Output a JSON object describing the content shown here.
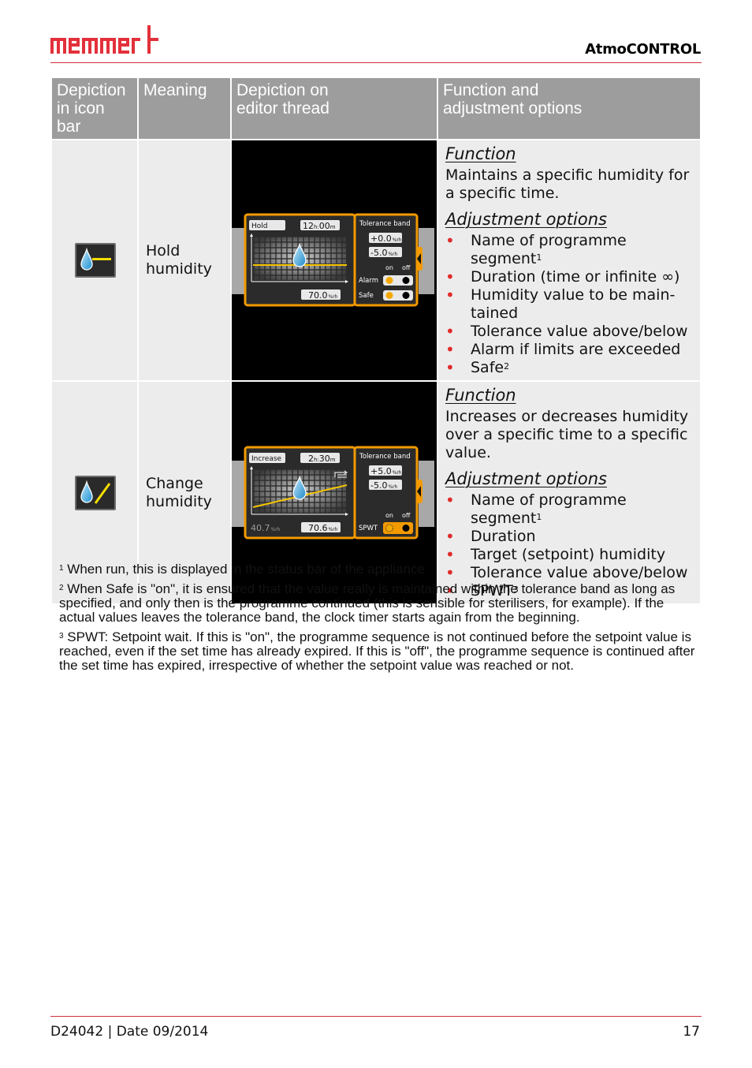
{
  "header": {
    "brand": "memmert",
    "product": "AtmoCONTROL",
    "brand_color": "#e3303b"
  },
  "table": {
    "columns": [
      "Depiction in icon bar",
      "Meaning",
      "Depiction on editor thread",
      "Function and adjustment options"
    ],
    "column_lines": [
      [
        "Depiction",
        "in icon bar"
      ],
      [
        "Meaning"
      ],
      [
        "Depiction on",
        "editor thread"
      ],
      [
        "Function and",
        "adjustment options"
      ]
    ],
    "rows": [
      {
        "icon": "hold-humidity-icon",
        "meaning_lines": [
          "Hold",
          "humidity"
        ],
        "thread": {
          "segment_name": "Hold",
          "duration_h": "12",
          "duration_m": "00",
          "unit_h": "h:",
          "unit_m": "m",
          "tolerance_title": "Tolerance band",
          "tol_plus": "+0.0",
          "tol_minus": "-5.0",
          "tol_unit": "%rh",
          "on_label": "on",
          "off_label": "off",
          "alarm_label": "Alarm",
          "safe_label": "Safe",
          "alarm_state": "on",
          "safe_state": "on",
          "setpoint": "70.0",
          "setpoint_unit": "%rh"
        },
        "function_heading": "Function",
        "function_text": "Maintains a specific humidity for a specific time.",
        "options_heading": "Adjustment options",
        "options": [
          {
            "text": "Name of programme segment",
            "sup": "1"
          },
          {
            "text": "Duration (time or infinite ∞)",
            "sup": ""
          },
          {
            "text": "Humidity value to be main-tained",
            "sup": ""
          },
          {
            "text": "Tolerance value above/below",
            "sup": ""
          },
          {
            "text": "Alarm if limits are exceeded",
            "sup": ""
          },
          {
            "text": "Safe",
            "sup": "2"
          }
        ]
      },
      {
        "icon": "change-humidity-icon",
        "meaning_lines": [
          "Change",
          "humidity"
        ],
        "thread": {
          "segment_name": "Increase",
          "duration_h": "2",
          "duration_m": "30",
          "unit_h": "h:",
          "unit_m": "m",
          "tolerance_title": "Tolerance band",
          "tol_plus": "+5.0",
          "tol_minus": "-5.0",
          "tol_unit": "%rh",
          "on_label": "on",
          "off_label": "off",
          "spwt_label": "SPWT",
          "spwt_state": "on",
          "start_value": "40.7",
          "setpoint": "70.6",
          "setpoint_unit": "%rh"
        },
        "function_heading": "Function",
        "function_text": "Increases or decreases humidity over a specific time to a specific value.",
        "options_heading": "Adjustment options",
        "options": [
          {
            "text": "Name of programme segment",
            "sup": "1"
          },
          {
            "text": "Duration",
            "sup": ""
          },
          {
            "text": "Target (setpoint) humidity",
            "sup": ""
          },
          {
            "text": "Tolerance value above/below",
            "sup": ""
          },
          {
            "text": "SPWT",
            "sup": "3"
          }
        ]
      }
    ]
  },
  "footnotes": [
    {
      "num": "1",
      "text": "When run, this is displayed in the status bar of the appliance"
    },
    {
      "num": "2",
      "text": "When Safe is \"on\", it is ensured that the value really is maintained within the tolerance band as long as specified, and only then is the programme continued (this is sensible for sterilisers, for example). If the actual values leaves the tolerance band, the clock timer starts again from the beginning."
    },
    {
      "num": "3",
      "text": "SPWT: Setpoint wait. If this is \"on\", the programme sequence is not continued before the setpoint value is reached, even if the set time has already expired. If this is \"off\", the programme sequence is continued after the set time has expired, irrespective of whether the setpoint value was reached or not."
    }
  ],
  "footer": {
    "doc_id": "D24042 | Date 09/2014",
    "page": "17"
  },
  "colors": {
    "accent_orange": "#f39a00",
    "hold_line": "#f5c400",
    "bullet_red": "#e02a2a",
    "rule_red": "#d32f38",
    "header_gray": "#9d9d9d",
    "cell_gray": "#ececec"
  }
}
